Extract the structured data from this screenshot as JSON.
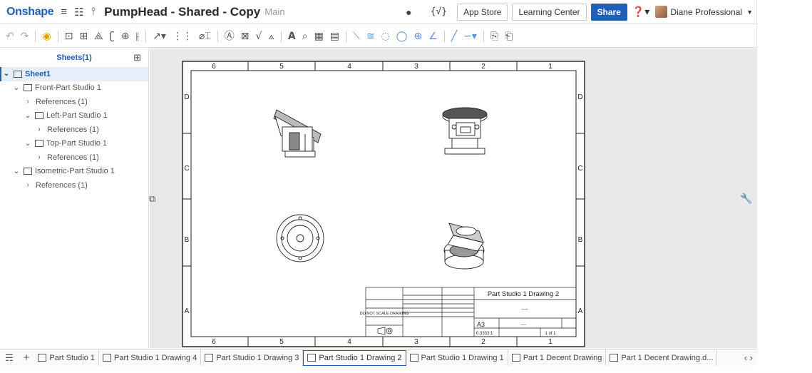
{
  "header": {
    "logo": "Onshape",
    "doc_title": "PumpHead - Shared - Copy",
    "branch": "Main",
    "app_store": "App Store",
    "learning_center": "Learning Center",
    "share": "Share",
    "user": "Diane Professional"
  },
  "sidebar": {
    "title": "Sheets(1)",
    "items": [
      {
        "label": "Sheet1"
      },
      {
        "label": "Front-Part Studio 1"
      },
      {
        "label": "References (1)"
      },
      {
        "label": "Left-Part Studio 1"
      },
      {
        "label": "References (1)"
      },
      {
        "label": "Top-Part Studio 1"
      },
      {
        "label": "References (1)"
      },
      {
        "label": "Isometric-Part Studio 1"
      },
      {
        "label": "References (1)"
      }
    ]
  },
  "drawing": {
    "top_zones": [
      "6",
      "5",
      "4",
      "3",
      "2",
      "1"
    ],
    "bottom_zones": [
      "6",
      "5",
      "4",
      "3",
      "2",
      "1"
    ],
    "side_zones": [
      "D",
      "C",
      "B",
      "A"
    ],
    "title_block": {
      "title": "Part Studio 1 Drawing 2",
      "do_not_scale": "DO NOT SCALE DRAWING",
      "size": "A3",
      "scale": "0.3333:1",
      "sheet": "1 of 1",
      "dash": "----"
    }
  },
  "tabs": [
    {
      "label": "Part Studio 1"
    },
    {
      "label": "Part Studio 1 Drawing 4"
    },
    {
      "label": "Part Studio 1 Drawing 3"
    },
    {
      "label": "Part Studio 1 Drawing 2"
    },
    {
      "label": "Part Studio 1 Drawing 1"
    },
    {
      "label": "Part 1 Decent Drawing"
    },
    {
      "label": "Part 1 Decent Drawing.d..."
    }
  ],
  "colors": {
    "accent": "#1f5fb8",
    "warn": "#e2a300"
  }
}
